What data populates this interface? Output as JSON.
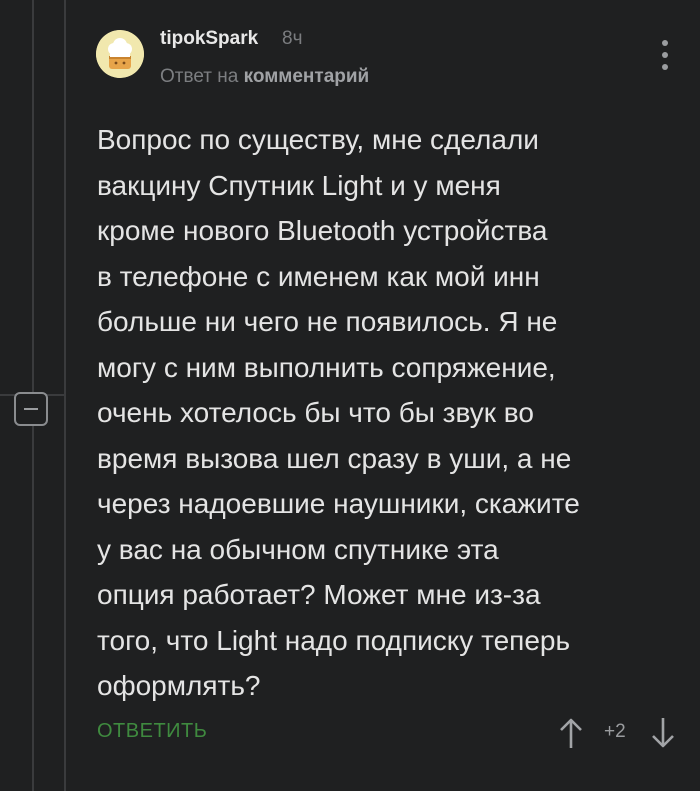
{
  "comment": {
    "username": "tipokSpark",
    "time": "8ч",
    "reply_prefix": "Ответ на",
    "reply_link": "комментарий",
    "text": "Вопрос по существу, мне сделали\nвакцину Спутник Light и у меня\nкроме нового Bluetooth устройства\nв телефоне с именем как мой инн\nбольше ни чего не появилось. Я не\nмогу с ним выполнить сопряжение,\nочень хотелось бы что бы звук во\nвремя вызова шел сразу в уши, а не\nчерез надоевшие наушники, скажите\nу вас на обычном спутнике эта\nопция работает? Может мне из-за\nтого, что Light надо подписку теперь\nоформлять?",
    "reply_button": "ОТВЕТИТЬ",
    "score": "+2"
  },
  "icons": {
    "avatar": "chef-hat-avatar",
    "menu": "vertical-dots-icon",
    "collapse": "minus-icon",
    "upvote": "arrow-up-icon",
    "downvote": "arrow-down-icon"
  },
  "colors": {
    "background": "#1f2021",
    "reply_button": "#3f8a3f",
    "muted": "#7a7c7f"
  }
}
